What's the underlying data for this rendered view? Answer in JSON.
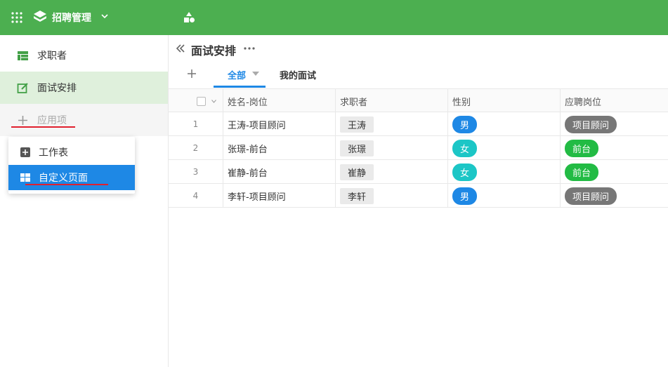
{
  "header": {
    "app_name": "招聘管理",
    "colors": {
      "bar": "#4caf50"
    }
  },
  "sidebar": {
    "items": [
      {
        "label": "求职者",
        "icon": "table-icon"
      },
      {
        "label": "面试安排",
        "icon": "edit-icon",
        "active": true
      },
      {
        "label": "应用项",
        "icon": "plus-icon"
      }
    ]
  },
  "dropdown": {
    "items": [
      {
        "label": "工作表",
        "icon": "sheet-plus-icon"
      },
      {
        "label": "自定义页面",
        "icon": "grid-icon",
        "highlighted": true
      }
    ]
  },
  "main": {
    "title": "面试安排",
    "tabs": [
      {
        "label": "全部",
        "active": true
      },
      {
        "label": "我的面试"
      }
    ],
    "table": {
      "columns": [
        "姓名-岗位",
        "求职者",
        "性别",
        "应聘岗位"
      ],
      "rows": [
        {
          "num": "1",
          "name_post": "王涛-项目顾问",
          "applicant": "王涛",
          "gender": "男",
          "position": "项目顾问"
        },
        {
          "num": "2",
          "name_post": "张璟-前台",
          "applicant": "张璟",
          "gender": "女",
          "position": "前台"
        },
        {
          "num": "3",
          "name_post": "崔静-前台",
          "applicant": "崔静",
          "gender": "女",
          "position": "前台"
        },
        {
          "num": "4",
          "name_post": "李轩-项目顾问",
          "applicant": "李轩",
          "gender": "男",
          "position": "项目顾问"
        }
      ]
    }
  },
  "colors": {
    "male": "#1e88e5",
    "female": "#1cc6c6",
    "frontdesk": "#22bb44",
    "consultant": "#777777",
    "accent": "#1e88e5",
    "annotation_red": "#e0202e"
  }
}
